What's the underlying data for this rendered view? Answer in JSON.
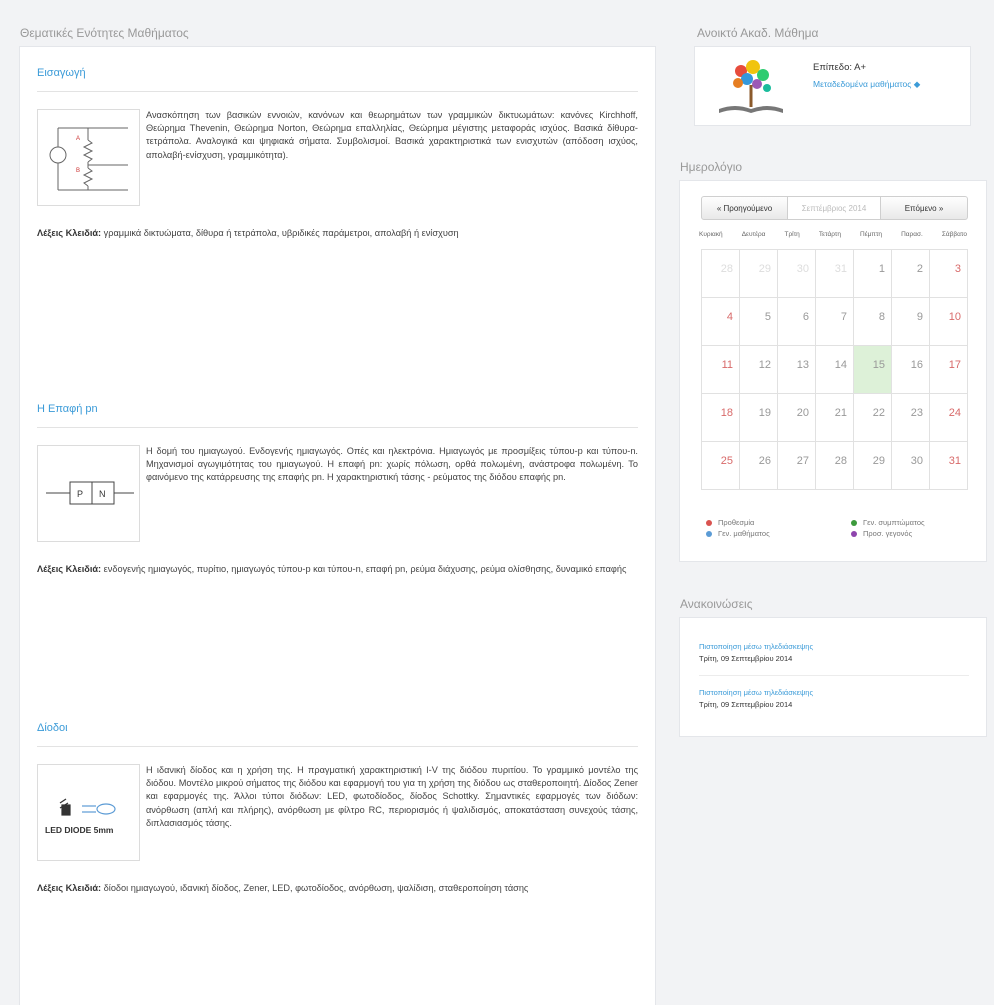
{
  "main": {
    "heading": "Θεματικές Ενότητες Μαθήματος",
    "units": [
      {
        "title": "Εισαγωγή",
        "image_icon": "circuit-diagram-icon",
        "description": "Ανασκόπηση των βασικών εννοιών, κανόνων και θεωρημάτων των γραμμικών δικτυωμάτων: κανόνες Kirchhoff, Θεώρημα Thevenin, Θεώρημα Norton, Θεώρημα επαλληλίας, Θεώρημα μέγιστης μεταφοράς ισχύος. Βασικά δίθυρα-τετράπολα. Αναλογικά και ψηφιακά σήματα. Συμβολισμοί. Βασικά χαρακτηριστικά των ενισχυτών (απόδοση ισχύος, απολαβή-ενίσχυση, γραμμικότητα).",
        "keywords_label": "Λέξεις Κλειδιά:",
        "keywords": "γραμμικά δικτυώματα, δίθυρα ή τετράπολα, υβριδικές παράμετροι, απολαβή ή ενίσχυση"
      },
      {
        "title": "Η Επαφή pn",
        "image_icon": "pn-junction-icon",
        "image_labels": [
          "P",
          "N"
        ],
        "description": "Η δομή του ημιαγωγού. Ενδογενής ημιαγωγός. Οπές και ηλεκτρόνια. Ημιαγωγός με προσμίξεις τύπου-p και τύπου-n. Μηχανισμοί αγωγιμότητας του ημιαγωγού. Η επαφή pn: χωρίς πόλωση, ορθά πολωμένη, ανάστροφα πολωμένη. Το φαινόμενο της κατάρρευσης της επαφής pn. Η χαρακτηριστική τάσης - ρεύματος της διόδου επαφής pn.",
        "keywords_label": "Λέξεις Κλειδιά:",
        "keywords": "ενδογενής ημιαγωγός, πυρίτιο, ημιαγωγός τύπου-p και τύπου-n, επαφή pn, ρεύμα διάχυσης, ρεύμα ολίσθησης, δυναμικό επαφής"
      },
      {
        "title": "Δίοδοι",
        "image_icon": "led-diode-icon",
        "image_caption": "LED DIODE 5mm",
        "description": "Η ιδανική δίοδος και η χρήση της. Η πραγματική χαρακτηριστική I-V της διόδου πυριτίου. Το γραμμικό μοντέλο της διόδου. Μοντέλο μικρού σήματος της διόδου και εφαρμογή του για τη χρήση της διόδου ως σταθεροποιητή. Δίοδος Zener και εφαρμογές της. Άλλοι τύποι διόδων: LED, φωτοδίοδος, δίοδος Schottky. Σημαντικές εφαρμογές των διόδων: ανόρθωση (απλή και πλήρης), ανόρθωση με φίλτρο RC, περιορισμός ή ψαλιδισμός, αποκατάσταση συνεχούς τάσης, διπλασιασμός τάσης.",
        "keywords_label": "Λέξεις Κλειδιά:",
        "keywords": "δίοδοι ημιαγωγού, ιδανική δίοδος, Zener, LED, φωτοδίοδος, ανόρθωση, ψαλίδιση, σταθεροποίηση τάσης"
      }
    ]
  },
  "sidebar": {
    "open_course": {
      "heading": "Ανοικτό Ακαδ. Μάθημα",
      "logo_icon": "open-courses-tree-logo",
      "level": "Επίπεδο: Α+",
      "metadata_link": "Μεταδεδομένα μαθήματος"
    },
    "calendar": {
      "heading": "Ημερολόγιο",
      "prev_label": "« Προηγούμενο",
      "month_label": "Σεπτέμβριος 2014",
      "next_label": "Επόμενο »",
      "weekdays": [
        "Κυριακή",
        "Δευτέρα",
        "Τρίτη",
        "Τετάρτη",
        "Πέμπτη",
        "Παρασ.",
        "Σάββατο"
      ],
      "days": [
        "28",
        "29",
        "30",
        "31",
        "1",
        "2",
        "3",
        "4",
        "5",
        "6",
        "7",
        "8",
        "9",
        "10",
        "11",
        "12",
        "13",
        "14",
        "15",
        "16",
        "17",
        "18",
        "19",
        "20",
        "21",
        "22",
        "23",
        "24",
        "25",
        "26",
        "27",
        "28",
        "29",
        "30",
        "31"
      ],
      "today": "15",
      "legend": [
        {
          "label": "Προθεσμία",
          "color": "#d9534f"
        },
        {
          "label": "Γεν. συμπτώματος",
          "color": "#3c9a3c"
        },
        {
          "label": "Γεν. μαθήματος",
          "color": "#5b9bd5"
        },
        {
          "label": "Προσ. γεγονός",
          "color": "#8e44ad"
        }
      ]
    },
    "announcements": {
      "heading": "Ανακοινώσεις",
      "items": [
        {
          "title": "Πιστοποίηση μέσω τηλεδιάσκεψης",
          "date": "Τρίτη, 09 Σεπτεμβρίου 2014"
        },
        {
          "title": "Πιστοποίηση μέσω τηλεδιάσκεψης",
          "date": "Τρίτη, 09 Σεπτεμβρίου 2014"
        }
      ]
    }
  }
}
